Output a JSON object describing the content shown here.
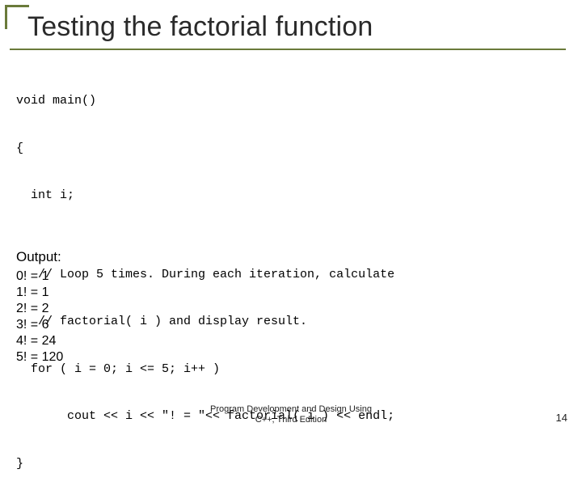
{
  "title": "Testing the factorial function",
  "code": {
    "l1": "void main()",
    "l2": "{",
    "l3": "  int i;",
    "l4": "",
    "l5": "   // Loop 5 times. During each iteration, calculate",
    "l6": "   // factorial( i ) and display result.",
    "l7": "  for ( i = 0; i <= 5; i++ )",
    "l8": "       cout << i << \"! = \"<< factorial( i ) << endl;",
    "l9": "}"
  },
  "output_label": "Output:",
  "output": {
    "r0": "0! = 1",
    "r1": "1! = 1",
    "r2": "2! = 2",
    "r3": "3! = 6",
    "r4": "4! = 24",
    "r5": "5! = 120"
  },
  "footer": {
    "line1": "Program Development and Design Using",
    "line2": "C++, Third Edition"
  },
  "page_number": "14"
}
